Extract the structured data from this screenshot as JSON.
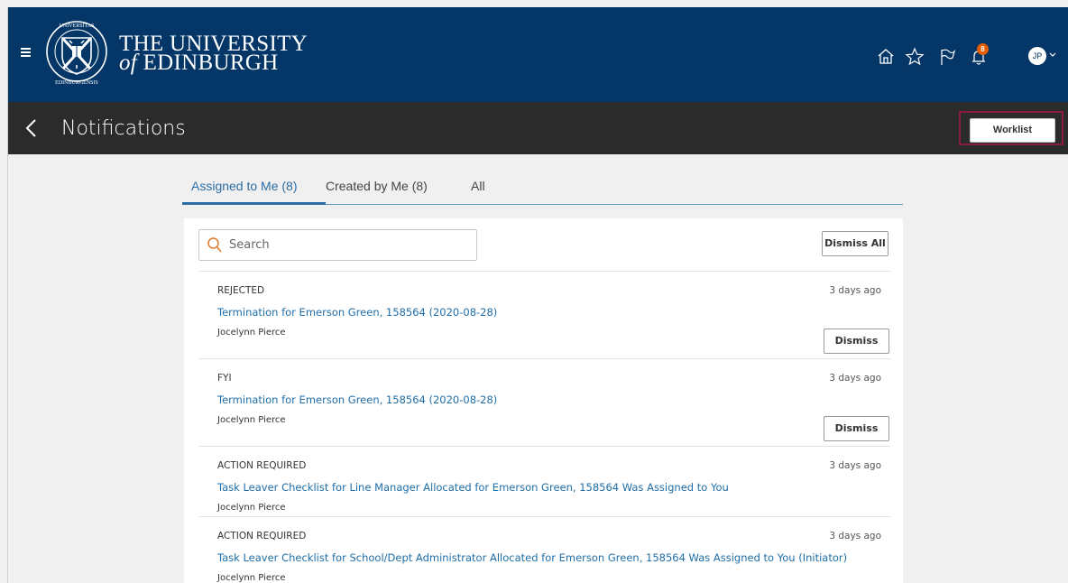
{
  "header": {
    "university_line1": "THE UNIVERSITY",
    "university_line2_prefix": "of",
    "university_line2": "EDINBURGH",
    "crest_text": "THE UNIVERSITY OF EDINBURGH",
    "notification_count": "8",
    "avatar_initials": "JP",
    "icons": [
      "menu-icon",
      "home-icon",
      "star-icon",
      "flag-icon",
      "bell-icon",
      "avatar"
    ]
  },
  "titlebar": {
    "title": "Notifications",
    "worklist_label": "Worklist"
  },
  "tabs": [
    {
      "label": "Assigned to Me (8)",
      "active": true
    },
    {
      "label": "Created by Me (8)",
      "active": false
    },
    {
      "label": "All",
      "active": false
    }
  ],
  "search": {
    "placeholder": "Search",
    "value": ""
  },
  "dismiss_all_label": "Dismiss All",
  "notifications": [
    {
      "status": "REJECTED",
      "time": "3 days ago",
      "title": "Termination for Emerson Green, 158564 (2020-08-28)",
      "from": "Jocelynn Pierce",
      "dismiss_label": "Dismiss"
    },
    {
      "status": "FYI",
      "time": "3 days ago",
      "title": "Termination for Emerson Green, 158564 (2020-08-28)",
      "from": "Jocelynn Pierce",
      "dismiss_label": "Dismiss"
    },
    {
      "status": "ACTION REQUIRED",
      "time": "3 days ago",
      "title": "Task Leaver Checklist for Line Manager Allocated for Emerson Green, 158564 Was Assigned to You",
      "from": "Jocelynn Pierce"
    },
    {
      "status": "ACTION REQUIRED",
      "time": "3 days ago",
      "title": "Task Leaver Checklist for School/Dept Administrator Allocated for Emerson Green, 158564 Was Assigned to You (Initiator)",
      "from": "Jocelynn Pierce"
    }
  ],
  "colors": {
    "header_bg": "#043768",
    "titlebar_bg": "#2b2b2b",
    "link": "#1f6ea8",
    "badge": "#e65c00",
    "highlight": "#8c1b3e"
  }
}
